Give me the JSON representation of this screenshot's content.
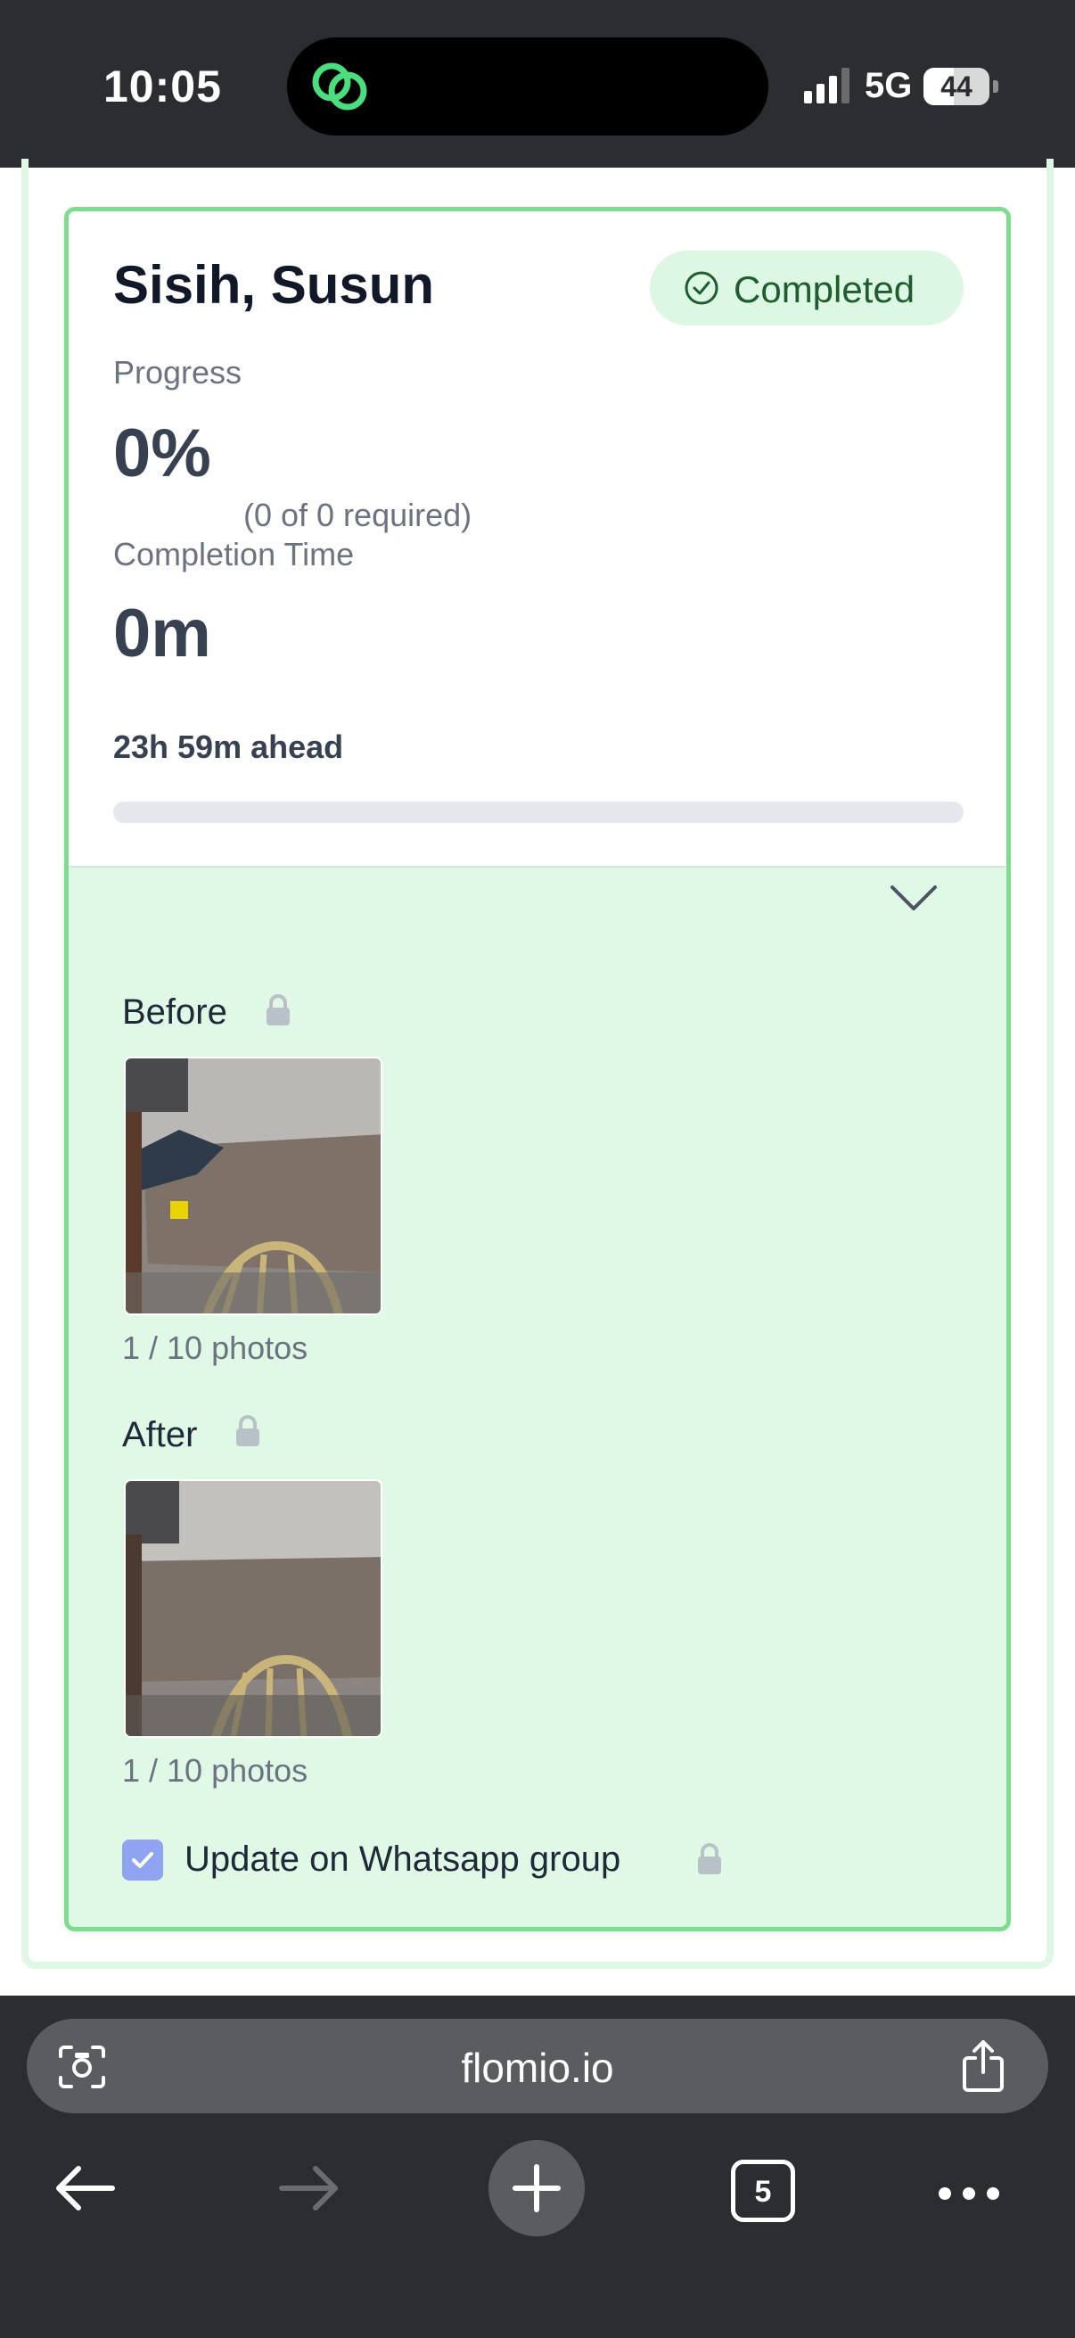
{
  "status_bar": {
    "time": "10:05",
    "network": "5G",
    "battery": "44"
  },
  "card": {
    "name": "Sisih, Susun",
    "status": "Completed",
    "progress_label": "Progress",
    "progress_value": "0%",
    "progress_required": "(0 of 0 required)",
    "completion_label": "Completion Time",
    "completion_value": "0m",
    "completion_ahead": "23h 59m ahead",
    "progress_bar_fraction": 0
  },
  "details": {
    "before_title": "Before",
    "before_count": "1 / 10 photos",
    "after_title": "After",
    "after_count": "1 / 10 photos",
    "checkbox_label": "Update on Whatsapp group",
    "checkbox_checked": true
  },
  "browser": {
    "url": "flomio.io",
    "tabs_count": "5"
  },
  "colors": {
    "accent_green": "#7ddc8f",
    "details_bg": "#e0f8e6",
    "badge_bg": "#dcf7e3",
    "checkbox": "#8fa3f0"
  }
}
